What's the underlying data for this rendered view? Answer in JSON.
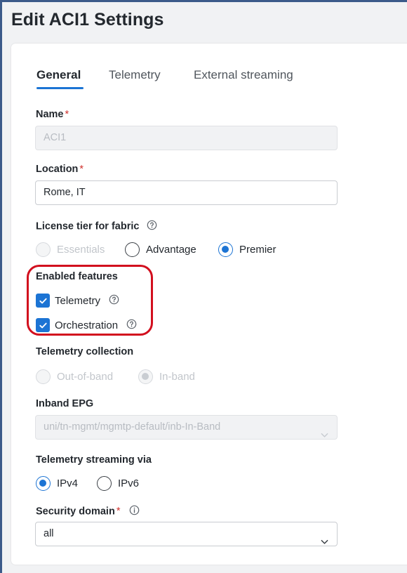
{
  "page": {
    "title": "Edit ACI1 Settings"
  },
  "tabs": [
    {
      "label": "General",
      "active": true
    },
    {
      "label": "Telemetry",
      "active": false
    },
    {
      "label": "External streaming",
      "active": false
    }
  ],
  "name": {
    "label": "Name",
    "required_mark": "*",
    "value": "ACI1",
    "disabled": true
  },
  "location": {
    "label": "Location",
    "required_mark": "*",
    "value": "Rome, IT"
  },
  "license": {
    "label": "License tier for fabric",
    "options": [
      {
        "label": "Essentials",
        "checked": false,
        "disabled": true
      },
      {
        "label": "Advantage",
        "checked": false,
        "disabled": false
      },
      {
        "label": "Premier",
        "checked": true,
        "disabled": false
      }
    ]
  },
  "features": {
    "label": "Enabled features",
    "items": [
      {
        "label": "Telemetry",
        "checked": true
      },
      {
        "label": "Orchestration",
        "checked": true
      }
    ]
  },
  "telemetry_collection": {
    "label": "Telemetry collection",
    "options": [
      {
        "label": "Out-of-band",
        "checked": false,
        "disabled": true
      },
      {
        "label": "In-band",
        "checked": true,
        "disabled": true
      }
    ]
  },
  "inband_epg": {
    "label": "Inband EPG",
    "value": "uni/tn-mgmt/mgmtp-default/inb-In-Band",
    "disabled": true
  },
  "streaming": {
    "label": "Telemetry streaming via",
    "options": [
      {
        "label": "IPv4",
        "checked": true
      },
      {
        "label": "IPv6",
        "checked": false
      }
    ]
  },
  "security_domain": {
    "label": "Security domain",
    "required_mark": "*",
    "value": "all"
  },
  "colors": {
    "accent": "#1c74d4",
    "required": "#d0312d",
    "highlight": "#d20f1e"
  },
  "icons": {
    "help": "help-circle-icon",
    "info": "info-circle-icon",
    "chevron": "chevron-down-icon",
    "check": "checkmark-icon"
  }
}
